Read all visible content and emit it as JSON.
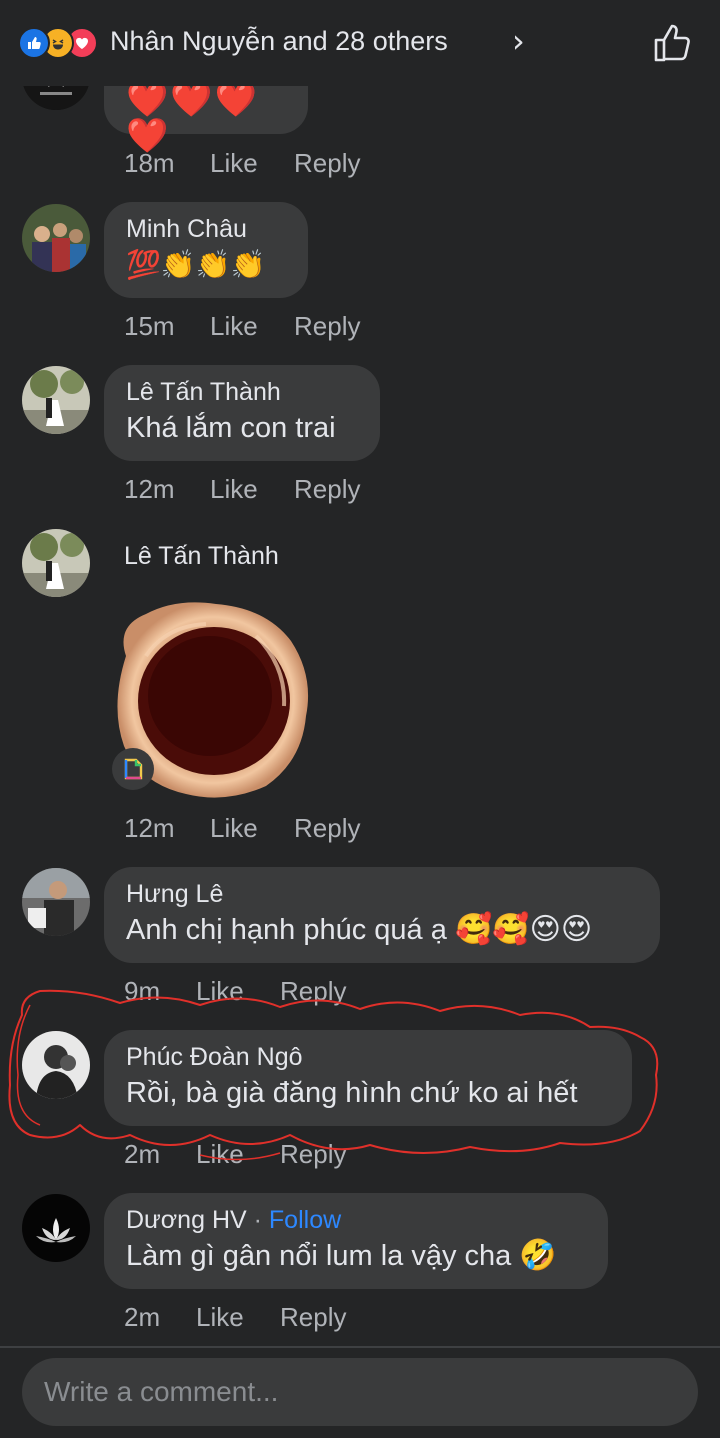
{
  "header": {
    "title": "Nhân Nguyễn and 28 others",
    "reaction_icons": [
      "like-icon",
      "haha-icon",
      "love-icon"
    ],
    "chevron_icon": "chevron-right-icon",
    "like_icon": "thumbs-up-icon"
  },
  "comments": [
    {
      "name": "",
      "text": "❤️❤️❤️❤️",
      "time": "18m",
      "like": "Like",
      "reply": "Reply"
    },
    {
      "name": "Minh Châu",
      "text": "💯👏👏👏",
      "time": "15m",
      "like": "Like",
      "reply": "Reply"
    },
    {
      "name": "Lê Tấn Thành",
      "text": "Khá lắm con trai",
      "time": "12m",
      "like": "Like",
      "reply": "Reply"
    },
    {
      "name": "Lê Tấn Thành",
      "text": "",
      "time": "12m",
      "like": "Like",
      "reply": "Reply",
      "attachment": "sticker"
    },
    {
      "name": "Hưng Lê",
      "text": "Anh chị hạnh phúc quá ạ",
      "emoji_suffix": "🥰🥰😍😍",
      "time": "9m",
      "like": "Like",
      "reply": "Reply"
    },
    {
      "name": "Phúc Đoàn Ngô",
      "text": "Rồi, bà già đăng hình chứ ko ai hết",
      "time": "2m",
      "like": "Like",
      "reply": "Reply"
    },
    {
      "name": "Dương HV",
      "follow": "Follow",
      "separator": "·",
      "text": "Làm gì gân nổi lum la vậy cha",
      "emoji_suffix": "🤣",
      "time": "2m",
      "like": "Like",
      "reply": "Reply"
    }
  ],
  "composer": {
    "placeholder": "Write a comment..."
  },
  "colors": {
    "background": "#242526",
    "bubble": "#3a3b3c",
    "text_primary": "#e4e6eb",
    "text_secondary": "#b0b3b8",
    "link": "#2d88ff",
    "annotation": "#e0302a"
  }
}
